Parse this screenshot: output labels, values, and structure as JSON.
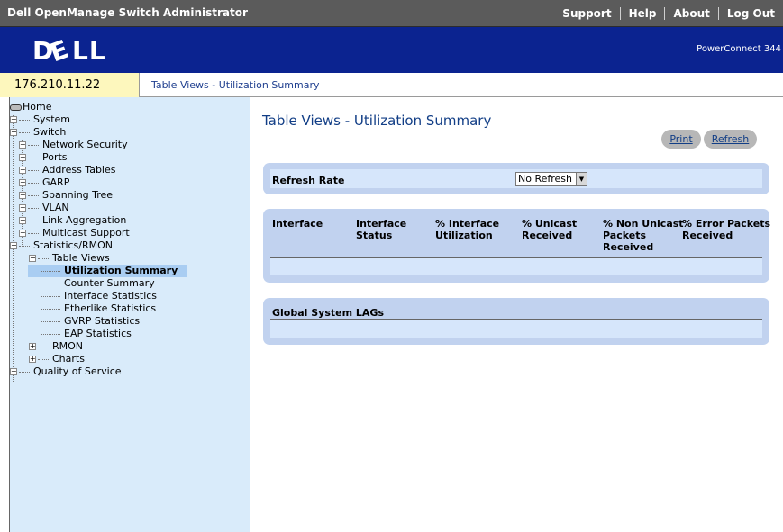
{
  "header": {
    "app_title": "Dell OpenManage Switch Administrator",
    "links": [
      "Support",
      "Help",
      "About",
      "Log Out"
    ],
    "logo": "D¢LL",
    "product": "PowerConnect 344"
  },
  "ipbar": {
    "ip": "176.210.11.22",
    "breadcrumb": "Table Views - Utilization Summary"
  },
  "tree": {
    "home": "Home",
    "system": "System",
    "switch": "Switch",
    "network_security": "Network Security",
    "ports": "Ports",
    "address_tables": "Address Tables",
    "garp": "GARP",
    "spanning_tree": "Spanning Tree",
    "vlan": "VLAN",
    "link_aggregation": "Link Aggregation",
    "multicast_support": "Multicast Support",
    "statistics_rmon": "Statistics/RMON",
    "table_views": "Table Views",
    "utilization_summary": "Utilization Summary",
    "counter_summary": "Counter Summary",
    "interface_statistics": "Interface Statistics",
    "etherlike_statistics": "Etherlike Statistics",
    "gvrp_statistics": "GVRP Statistics",
    "eap_statistics": "EAP Statistics",
    "rmon": "RMON",
    "charts": "Charts",
    "quality_of_service": "Quality of Service"
  },
  "main": {
    "title": "Table Views - Utilization Summary",
    "print_label": "Print",
    "refresh_label": "Refresh",
    "refresh_rate_label": "Refresh Rate",
    "refresh_rate_value": "No Refresh",
    "columns": {
      "interface": "Interface",
      "interface_status": [
        "Interface",
        "Status"
      ],
      "interface_utilization": [
        "% Interface",
        "Utilization"
      ],
      "unicast_received": [
        "% Unicast",
        "Received"
      ],
      "non_unicast": [
        "% Non Unicast",
        "Packets",
        "Received"
      ],
      "error_packets": [
        "% Error Packets",
        "Received"
      ]
    },
    "lags_label": "Global System LAGs"
  },
  "colors": {
    "brand_blue": "#0b2390",
    "title_blue": "#123e86",
    "panel_bg": "#c1d2ef",
    "tree_bg": "#d9ebfa",
    "ip_bg": "#fdf7bd"
  }
}
